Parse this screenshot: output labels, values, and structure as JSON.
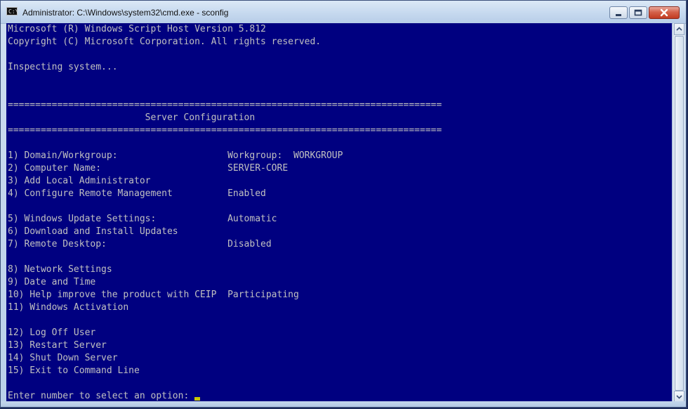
{
  "window": {
    "title": "Administrator: C:\\Windows\\system32\\cmd.exe - sconfig",
    "icon_text": "C:\\",
    "icon": "cmd-console-icon",
    "caption_icons": [
      "minimize-icon",
      "maximize-icon",
      "close-icon"
    ]
  },
  "colors": {
    "console_background": "#000080",
    "console_text": "#c0c0c0",
    "cursor": "#c8c800"
  },
  "console": {
    "lines": [
      "Microsoft (R) Windows Script Host Version 5.812",
      "Copyright (C) Microsoft Corporation. All rights reserved.",
      "",
      "Inspecting system...",
      "",
      "",
      "===============================================================================",
      "                         Server Configuration",
      "===============================================================================",
      "",
      "1) Domain/Workgroup:                    Workgroup:  WORKGROUP",
      "2) Computer Name:                       SERVER-CORE",
      "3) Add Local Administrator",
      "4) Configure Remote Management          Enabled",
      "",
      "5) Windows Update Settings:             Automatic",
      "6) Download and Install Updates",
      "7) Remote Desktop:                      Disabled",
      "",
      "8) Network Settings",
      "9) Date and Time",
      "10) Help improve the product with CEIP  Participating",
      "11) Windows Activation",
      "",
      "12) Log Off User",
      "13) Restart Server",
      "14) Shut Down Server",
      "15) Exit to Command Line",
      ""
    ],
    "prompt": "Enter number to select an option: "
  }
}
